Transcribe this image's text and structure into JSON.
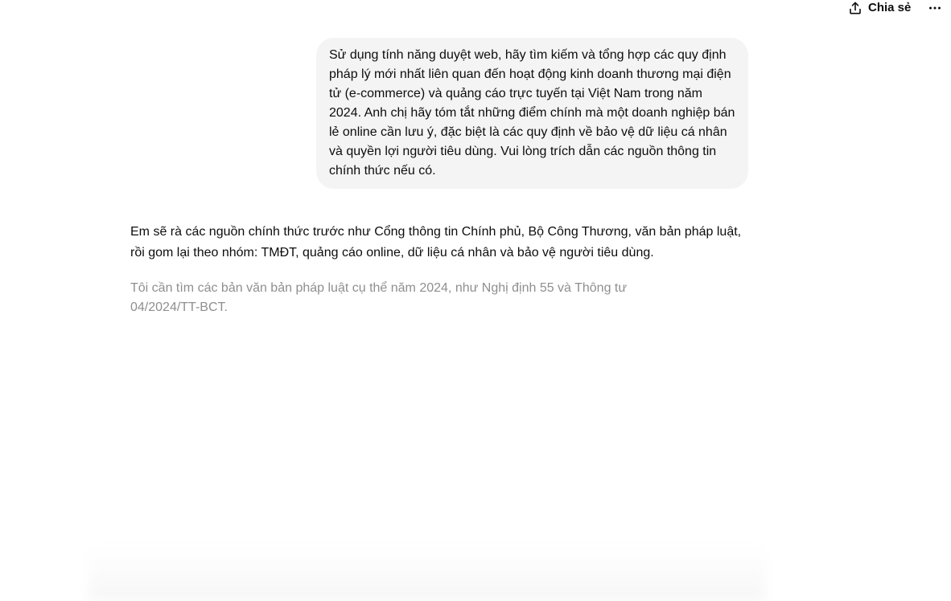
{
  "header": {
    "share_label": "Chia sẻ",
    "share_icon": "share-upload-icon",
    "more_icon": "ellipsis-icon"
  },
  "conversation": {
    "user_message": "Sử dụng tính năng duyệt web, hãy tìm kiếm và tổng hợp các quy định pháp lý mới nhất liên quan đến hoạt động kinh doanh thương mại điện tử (e-commerce) và quảng cáo trực tuyến tại Việt Nam trong năm 2024. Anh chị hãy tóm tắt những điểm chính mà một doanh nghiệp bán lẻ online cần lưu ý, đặc biệt là các quy định về bảo vệ dữ liệu cá nhân và quyền lợi người tiêu dùng. Vui lòng trích dẫn các nguồn thông tin chính thức nếu có.",
    "assistant_message": "Em sẽ rà các nguồn chính thức trước như Cổng thông tin Chính phủ, Bộ Công Thương, văn bản pháp luật, rồi gom lại theo nhóm: TMĐT, quảng cáo online, dữ liệu cá nhân và bảo vệ người tiêu dùng.",
    "thinking_status": "Tôi cần tìm các bản văn bản pháp luật cụ thể năm 2024, như Nghị định 55 và Thông tư 04/2024/TT-BCT."
  },
  "colors": {
    "bubble_bg": "#f4f4f4",
    "text_primary": "#0d0d0d",
    "text_muted": "#8f8f8f"
  }
}
